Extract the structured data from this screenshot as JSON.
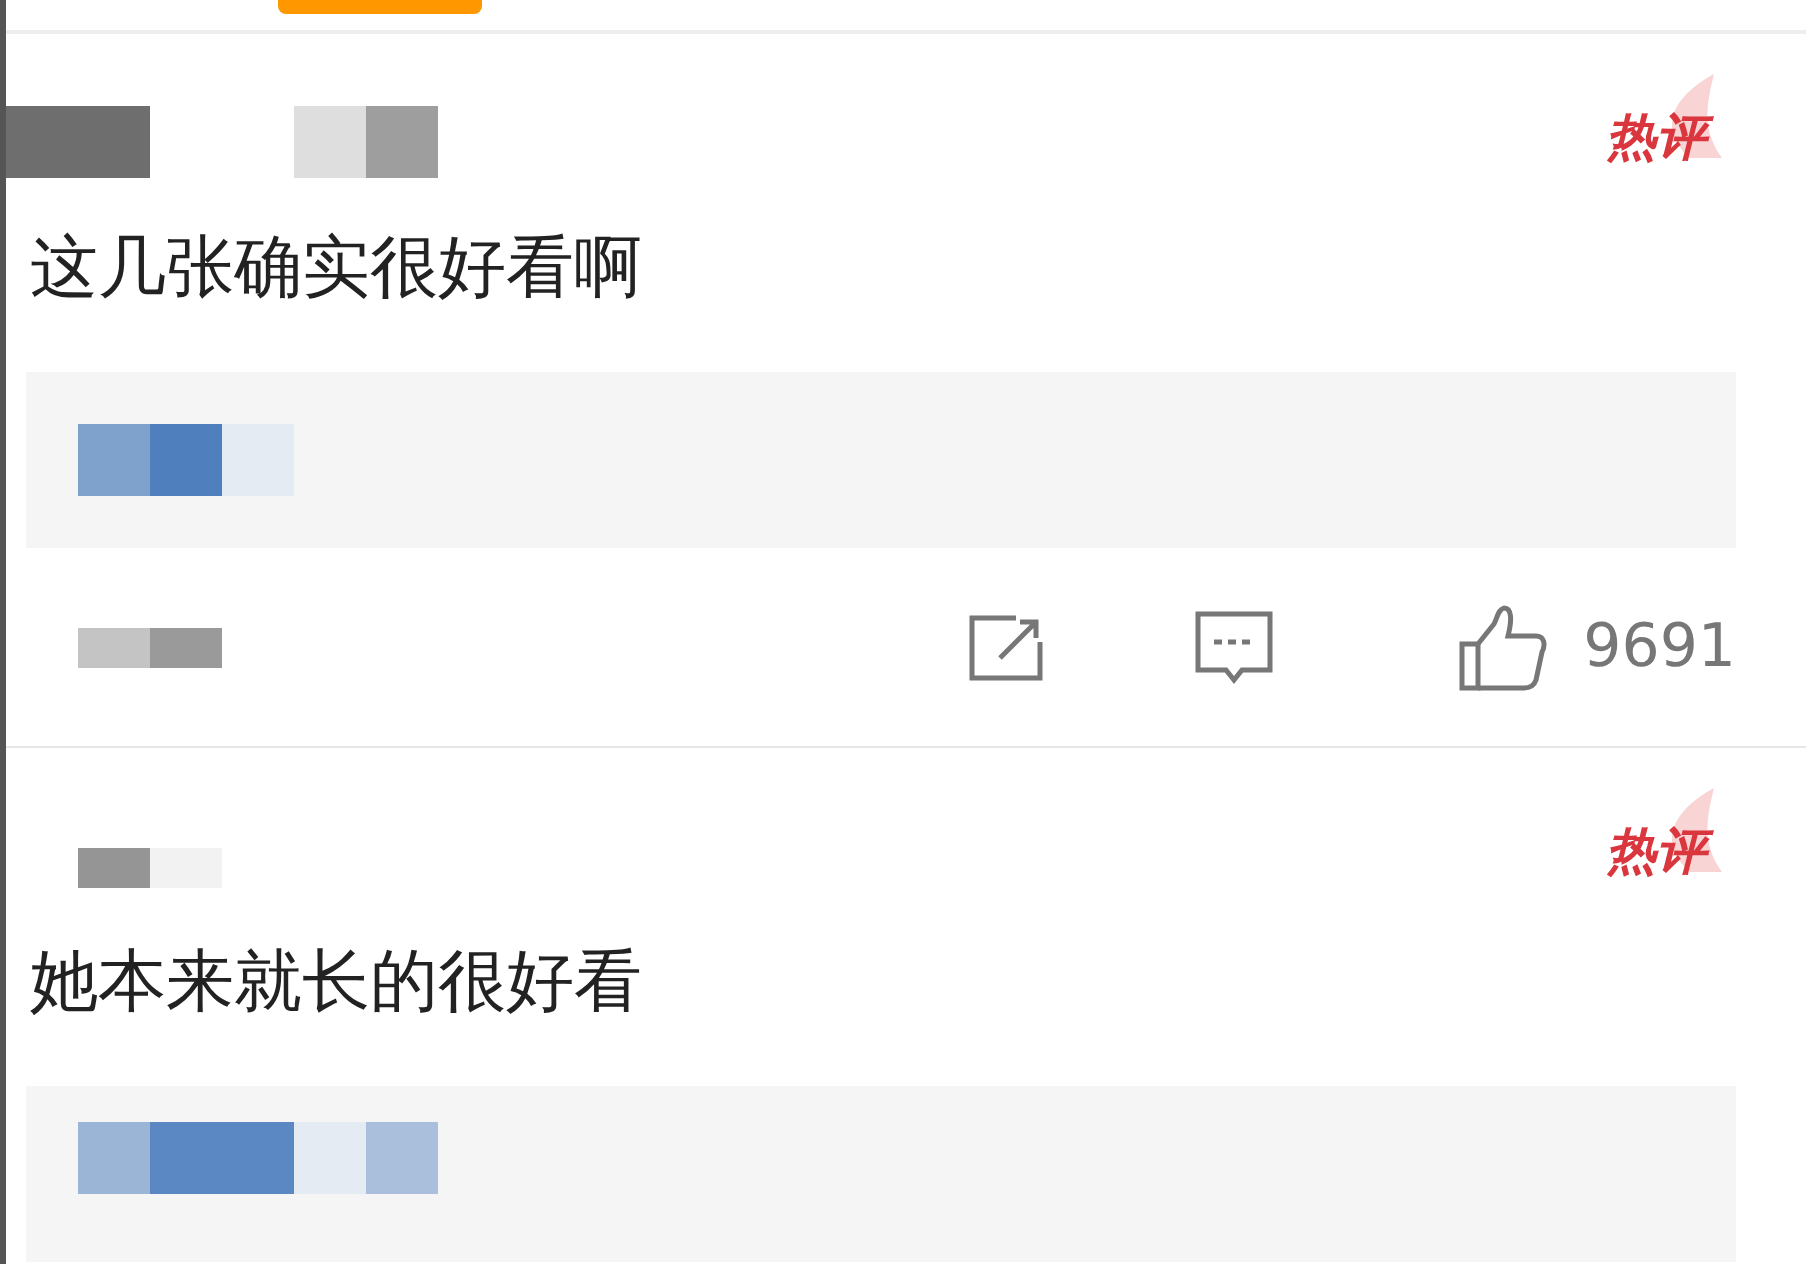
{
  "comments": [
    {
      "badge": "热评",
      "text": "这几张确实很好看啊",
      "likes": "9691"
    },
    {
      "badge": "热评",
      "text": "她本来就长的很好看"
    }
  ]
}
